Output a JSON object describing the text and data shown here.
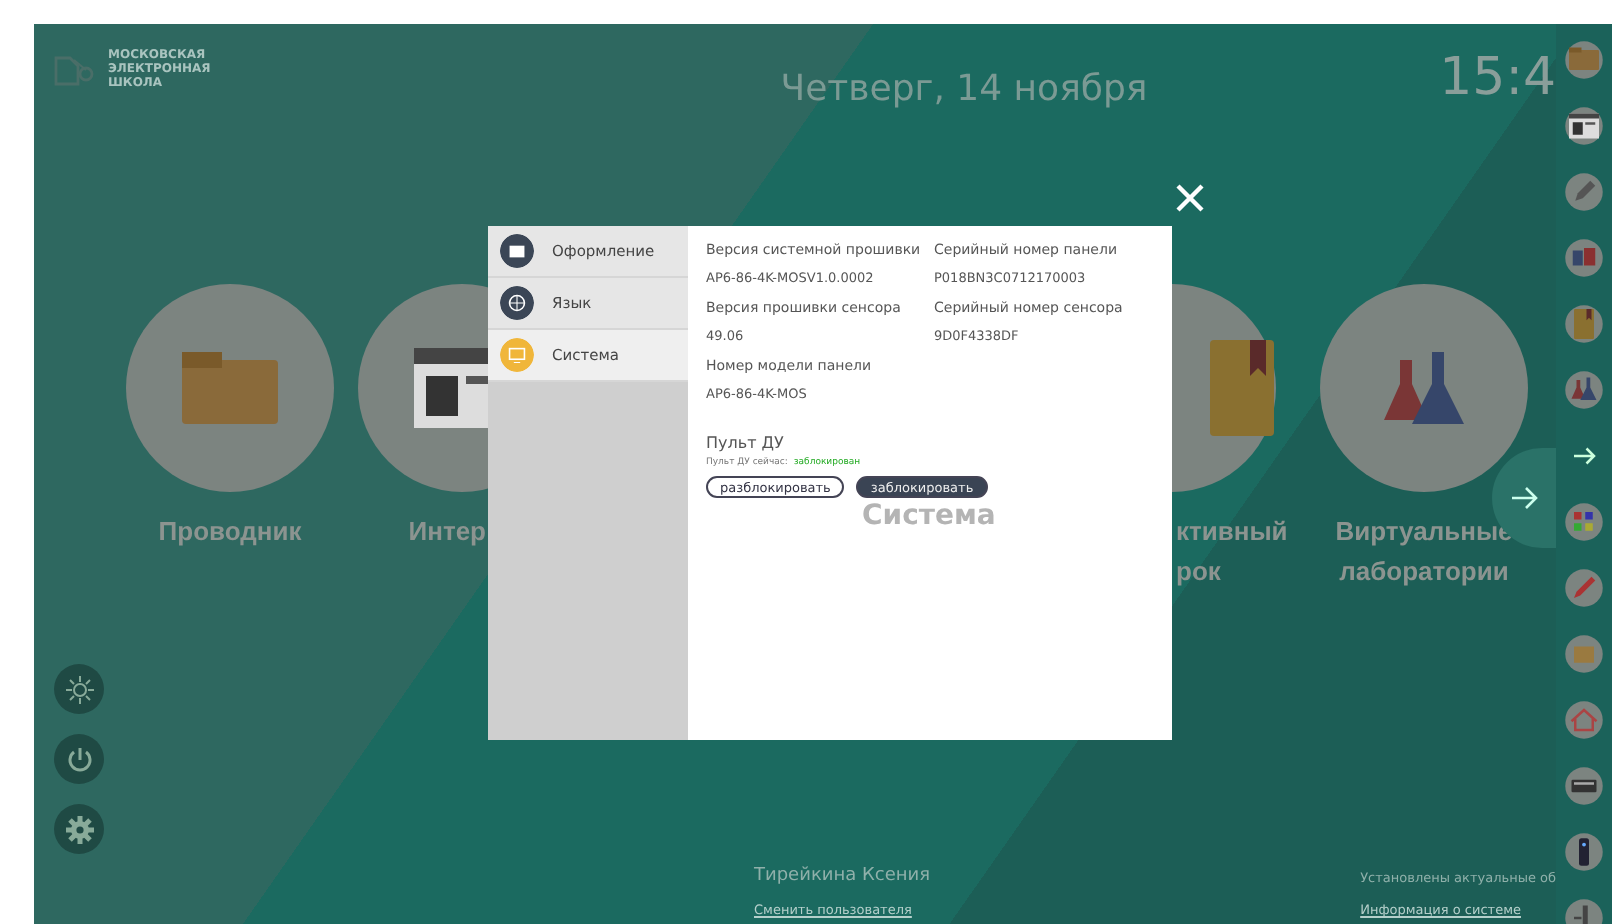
{
  "header": {
    "logo_lines": [
      "МОСКОВСКАЯ",
      "ЭЛЕКТРОННАЯ",
      "ШКОЛА"
    ],
    "date": "Четверг, 14 ноября",
    "time": "15:4"
  },
  "apps": [
    {
      "kind": "folder",
      "lines": [
        "Проводник"
      ]
    },
    {
      "kind": "browser",
      "lines": [
        "Интер"
      ]
    },
    {
      "kind": "book",
      "lines": [
        "ктивный",
        "рок"
      ]
    },
    {
      "kind": "flasks",
      "lines": [
        "Виртуальные",
        "лаборатории"
      ]
    }
  ],
  "side_buttons": [
    {
      "kind": "brightness"
    },
    {
      "kind": "power"
    },
    {
      "kind": "settings"
    }
  ],
  "footer": {
    "user": "Тирейкина Ксения",
    "switch_link": "Сменить пользователя",
    "status": "Установлены актуальные об",
    "info_link": "Информация о системе"
  },
  "dock": [
    {
      "kind": "folder"
    },
    {
      "kind": "browser"
    },
    {
      "kind": "pen"
    },
    {
      "kind": "boxes"
    },
    {
      "kind": "book"
    },
    {
      "kind": "flasks"
    },
    {
      "kind": "arrow"
    },
    {
      "kind": "grid"
    },
    {
      "kind": "pencil"
    },
    {
      "kind": "box"
    },
    {
      "kind": "home"
    },
    {
      "kind": "keyboard"
    },
    {
      "kind": "remote"
    },
    {
      "kind": "exit"
    }
  ],
  "dialog": {
    "menu": [
      {
        "kind": "design",
        "label": "Оформление",
        "selected": false
      },
      {
        "kind": "language",
        "label": "Язык",
        "selected": false
      },
      {
        "kind": "system",
        "label": "Система",
        "selected": true
      }
    ],
    "fields": [
      {
        "label": "Версия системной прошивки",
        "value": "AP6-86-4K-MOSV1.0.0002"
      },
      {
        "label": "Серийный номер панели",
        "value": "P018BN3C0712170003"
      },
      {
        "label": "Версия прошивки сенсора",
        "value": "49.06"
      },
      {
        "label": "Серийный номер сенсора",
        "value": "9D0F4338DF"
      },
      {
        "label": "Номер модели панели",
        "value": "AP6-86-4K-MOS"
      }
    ],
    "remote": {
      "title": "Пульт ДУ",
      "status_label": "Пульт ДУ сейчас:",
      "status_value": "заблокирован"
    },
    "buttons": [
      {
        "label": "разблокировать",
        "primary": false
      },
      {
        "label": "заблокировать",
        "primary": true
      }
    ],
    "watermark": "Система"
  }
}
